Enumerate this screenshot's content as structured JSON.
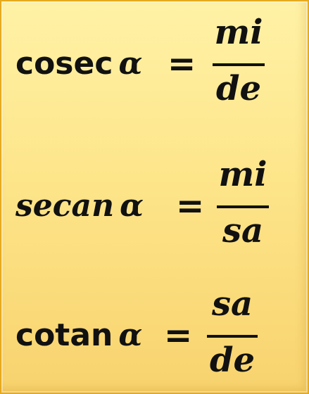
{
  "formulas": [
    {
      "function_name": "cosec",
      "variable": "α",
      "equals": "=",
      "numerator": "mi",
      "denominator": "de"
    },
    {
      "function_name": "secan",
      "variable": "α",
      "equals": "=",
      "numerator": "mi",
      "denominator": "sa"
    },
    {
      "function_name": "cotan",
      "variable": "α",
      "equals": "=",
      "numerator": "sa",
      "denominator": "de"
    }
  ]
}
